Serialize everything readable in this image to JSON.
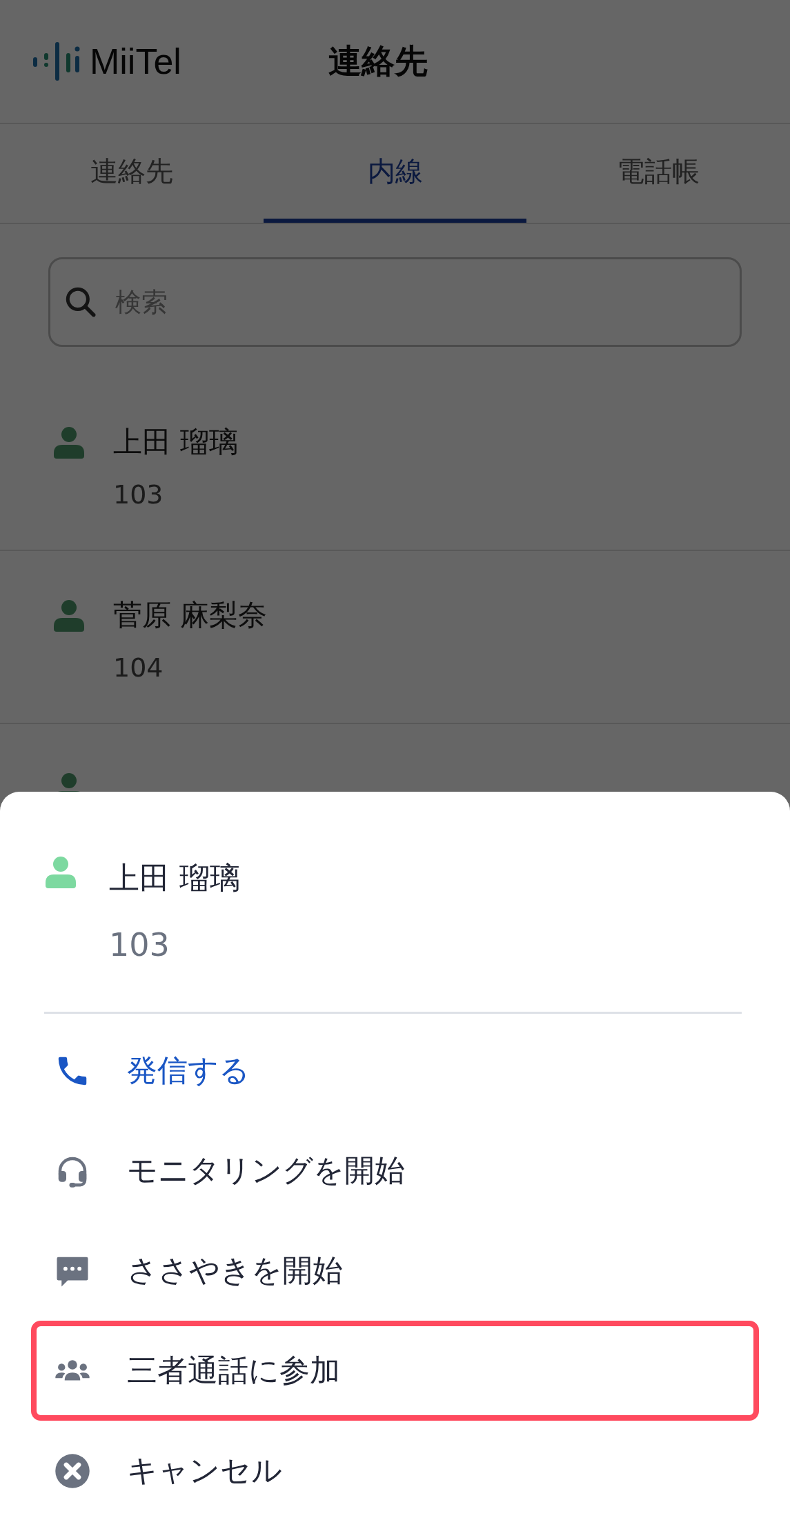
{
  "header": {
    "logo": "MiiTel",
    "title": "連絡先"
  },
  "tabs": [
    {
      "label": "連絡先",
      "selected": false
    },
    {
      "label": "内線",
      "selected": true
    },
    {
      "label": "電話帳",
      "selected": false
    }
  ],
  "search": {
    "placeholder": "検索"
  },
  "contacts": [
    {
      "name": "上田 瑠璃",
      "extension": "103"
    },
    {
      "name": "菅原 麻梨奈",
      "extension": "104"
    }
  ],
  "sheet": {
    "name": "上田 瑠璃",
    "extension": "103",
    "actions": [
      {
        "kind": "call",
        "label": "発信する",
        "highlighted": false
      },
      {
        "kind": "monitor",
        "label": "モニタリングを開始",
        "highlighted": false
      },
      {
        "kind": "whisper",
        "label": "ささやきを開始",
        "highlighted": false
      },
      {
        "kind": "conference",
        "label": "三者通話に参加",
        "highlighted": true
      },
      {
        "kind": "cancel",
        "label": "キャンセル",
        "highlighted": false
      }
    ]
  }
}
